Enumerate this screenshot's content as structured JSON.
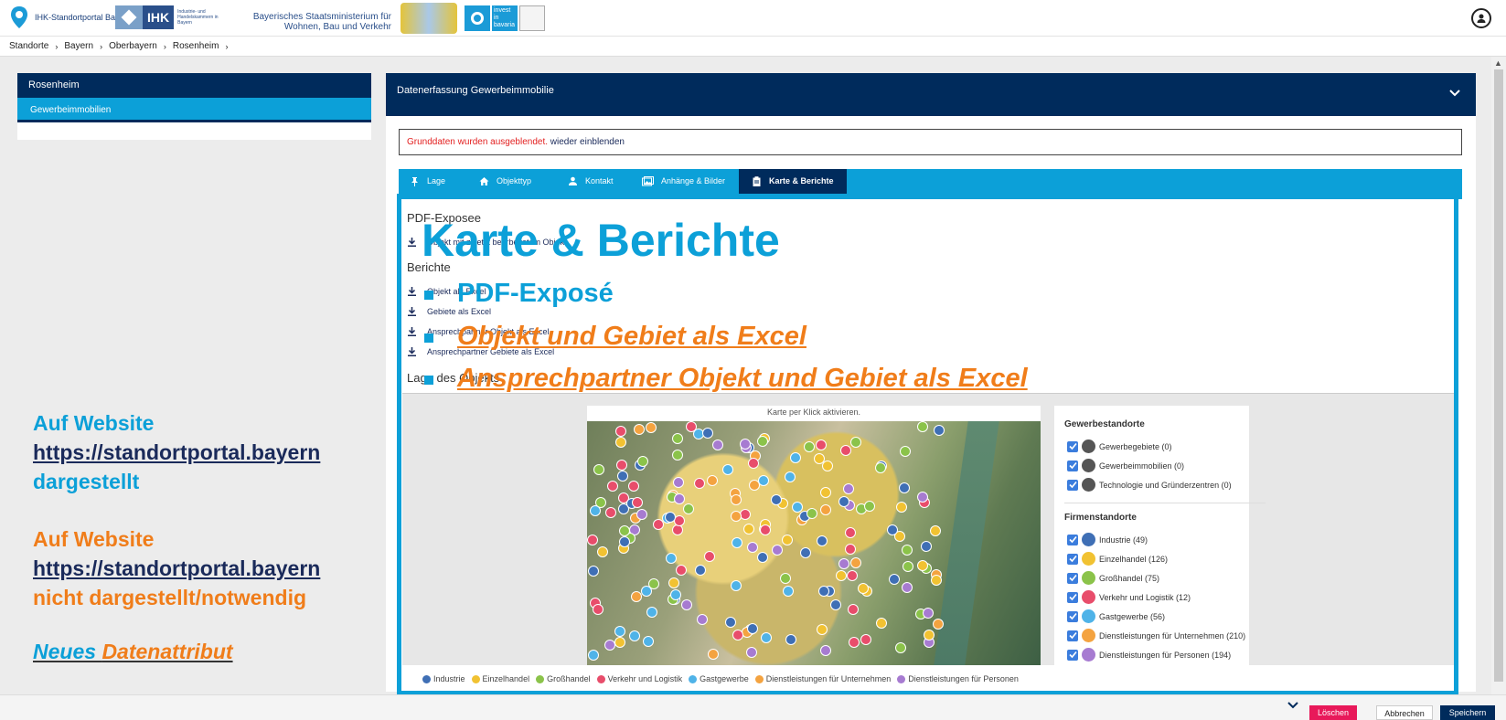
{
  "header": {
    "logo_standortportal": "IHK-Standortportal Bayern",
    "logo_ihk": "IHK",
    "logo_ihk_sub": "Industrie- und Handelskammern in Bayern",
    "ministry_line1": "Bayerisches Staatsministerium für",
    "ministry_line2": "Wohnen, Bau und Verkehr",
    "invest_text": "invest in bavaria"
  },
  "breadcrumb": [
    "Standorte",
    "Bayern",
    "Oberbayern",
    "Rosenheim"
  ],
  "sidebar": {
    "title": "Rosenheim",
    "item": "Gewerbeimmobilien"
  },
  "annotations": {
    "blue_line1": "Auf Website",
    "blue_url": "https://standortportal.bayern",
    "blue_line3": "dargestellt",
    "orange_line1": "Auf Website",
    "orange_url": "https://standortportal.bayern",
    "orange_line3": "nicht dargestellt/notwendig",
    "new_a": "Neues ",
    "new_b": "Datenattribut"
  },
  "main": {
    "title": "Datenerfassung Gewerbeimmobilie",
    "notice_red": "Grunddaten wurden ausgeblendet.",
    "notice_link": "wieder einblenden",
    "tabs": [
      {
        "label": "Lage",
        "icon": "pin-icon"
      },
      {
        "label": "Objekttyp",
        "icon": "home-icon"
      },
      {
        "label": "Kontakt",
        "icon": "person-icon"
      },
      {
        "label": "Anhänge & Bilder",
        "icon": "images-icon"
      },
      {
        "label": "Karte & Berichte",
        "icon": "clipboard-icon",
        "active": true
      }
    ],
    "section_pdf": "PDF-Exposee",
    "pdf_link": "Objekt mit zuletzt bearbeitetem Objekt",
    "section_reports": "Berichte",
    "report_links": [
      "Objekt als Excel",
      "Gebiete als Excel",
      "Ansprechpartner Objekt als Excel",
      "Ansprechpartner Gebiete als Excel"
    ],
    "section_lage": "Lage des Objekts",
    "overlay_title": "Karte & Berichte",
    "overlay_items": [
      "PDF-Exposé",
      "Objekt und Gebiet als Excel",
      "Ansprechpartner Objekt und Gebiet als Excel"
    ],
    "map_hint": "Karte per Klick aktivieren."
  },
  "legend": {
    "group1_title": "Gewerbestandorte",
    "group1": [
      {
        "label": "Gewerbegebiete (0)",
        "color": "#555555"
      },
      {
        "label": "Gewerbeimmobilien (0)",
        "color": "#555555"
      },
      {
        "label": "Technologie und Gründerzentren (0)",
        "color": "#555555"
      }
    ],
    "group2_title": "Firmenstandorte",
    "group2": [
      {
        "label": "Industrie (49)",
        "color": "#3f6fb5"
      },
      {
        "label": "Einzelhandel (126)",
        "color": "#f1c232"
      },
      {
        "label": "Großhandel (75)",
        "color": "#8bc34a"
      },
      {
        "label": "Verkehr und Logistik (12)",
        "color": "#e84d6b"
      },
      {
        "label": "Gastgewerbe (56)",
        "color": "#4fb3e8"
      },
      {
        "label": "Dienstleistungen für Unternehmen (210)",
        "color": "#f4a340"
      },
      {
        "label": "Dienstleistungen für Personen (194)",
        "color": "#a77bd1"
      }
    ]
  },
  "bottom_legend": [
    {
      "label": "Industrie",
      "color": "#3f6fb5"
    },
    {
      "label": "Einzelhandel",
      "color": "#f1c232"
    },
    {
      "label": "Großhandel",
      "color": "#8bc34a"
    },
    {
      "label": "Verkehr und Logistik",
      "color": "#e84d6b"
    },
    {
      "label": "Gastgewerbe",
      "color": "#4fb3e8"
    },
    {
      "label": "Dienstleistungen für Unternehmen",
      "color": "#f4a340"
    },
    {
      "label": "Dienstleistungen für Personen",
      "color": "#a77bd1"
    }
  ],
  "footer": {
    "delete": "Löschen",
    "cancel": "Abbrechen",
    "save": "Speichern"
  },
  "colors": {
    "navy": "#002b5c",
    "accent_blue": "#0ca0d8",
    "orange": "#f07d1a",
    "delete_red": "#e8195a"
  }
}
